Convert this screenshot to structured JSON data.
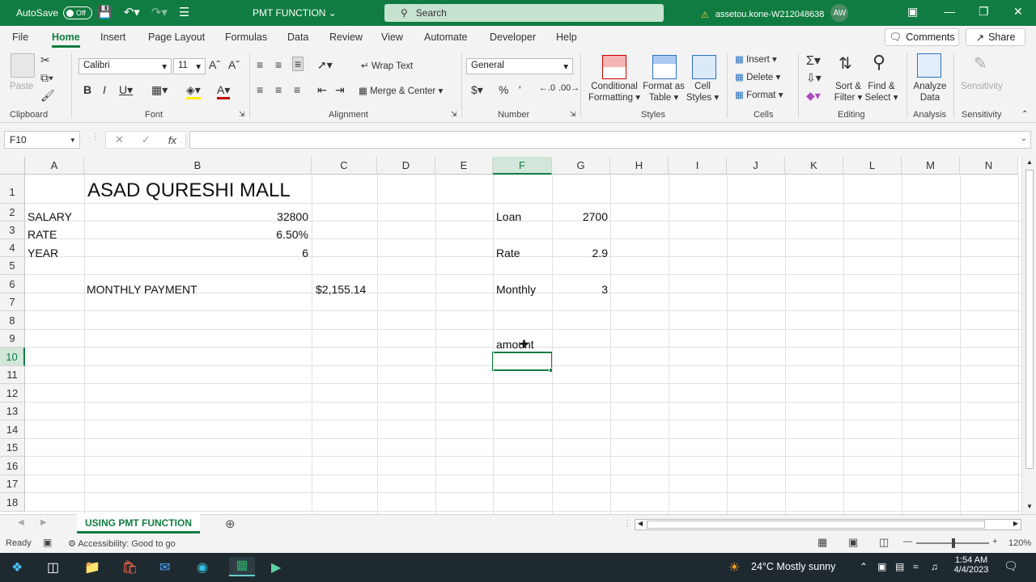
{
  "titlebar": {
    "autosave_label": "AutoSave",
    "autosave_state": "Off",
    "doc_title": "PMT FUNCTION",
    "search_placeholder": "Search",
    "account": "assetou.kone-W212048638",
    "avatar_initials": "AW"
  },
  "menu": {
    "tabs": [
      "File",
      "Home",
      "Insert",
      "Page Layout",
      "Formulas",
      "Data",
      "Review",
      "View",
      "Automate",
      "Developer",
      "Help"
    ],
    "active": "Home",
    "comments_label": "Comments",
    "share_label": "Share"
  },
  "ribbon": {
    "clipboard": {
      "paste": "Paste",
      "group": "Clipboard"
    },
    "font": {
      "name": "Calibri",
      "size": "11",
      "group": "Font"
    },
    "alignment": {
      "wrap_text": "Wrap Text",
      "merge_center": "Merge & Center",
      "group": "Alignment"
    },
    "number": {
      "format": "General",
      "group": "Number"
    },
    "styles": {
      "conditional": "Conditional",
      "conditional2": "Formatting",
      "format_as": "Format as",
      "format_as2": "Table",
      "cell_styles": "Cell",
      "cell_styles2": "Styles",
      "group": "Styles"
    },
    "cells": {
      "insert": "Insert",
      "delete": "Delete",
      "format": "Format",
      "group": "Cells"
    },
    "editing": {
      "sort": "Sort &",
      "sort2": "Filter",
      "find": "Find &",
      "find2": "Select",
      "group": "Editing"
    },
    "analysis": {
      "analyze": "Analyze",
      "analyze2": "Data",
      "group": "Analysis"
    },
    "sensitivity": {
      "label": "Sensitivity",
      "group": "Sensitivity"
    }
  },
  "formula_bar": {
    "name_box": "F10",
    "formula": "",
    "fx": "fx"
  },
  "sheet": {
    "columns": [
      "A",
      "B",
      "C",
      "D",
      "E",
      "F",
      "G",
      "H",
      "I",
      "J",
      "K",
      "L",
      "M",
      "N"
    ],
    "rows": [
      "1",
      "2",
      "3",
      "4",
      "5",
      "6",
      "7",
      "8",
      "9",
      "10",
      "11",
      "12",
      "13",
      "14",
      "15",
      "16",
      "17",
      "18"
    ],
    "selected_col": "F",
    "selected_row": "10",
    "cells": {
      "B1": "ASAD QURESHI MALL",
      "A2": "SALARY",
      "B2": "32800",
      "A3": "RATE",
      "B3": "6.50%",
      "A4": "YEAR",
      "B4": "6",
      "B6": "MONTHLY PAYMENT",
      "C6": "$2,155.14",
      "F2": "Loan",
      "G2": "2700",
      "F4": "Rate",
      "G4": "2.9",
      "F6": "Monthly",
      "G6": "3",
      "F9": "amount"
    }
  },
  "sheet_tab": "USING PMT FUNCTION",
  "status": {
    "ready": "Ready",
    "accessibility": "Accessibility: Good to go",
    "zoom": "120%"
  },
  "taskbar": {
    "weather": "24°C  Mostly sunny",
    "time": "1:54 AM",
    "date": "4/4/2023"
  }
}
